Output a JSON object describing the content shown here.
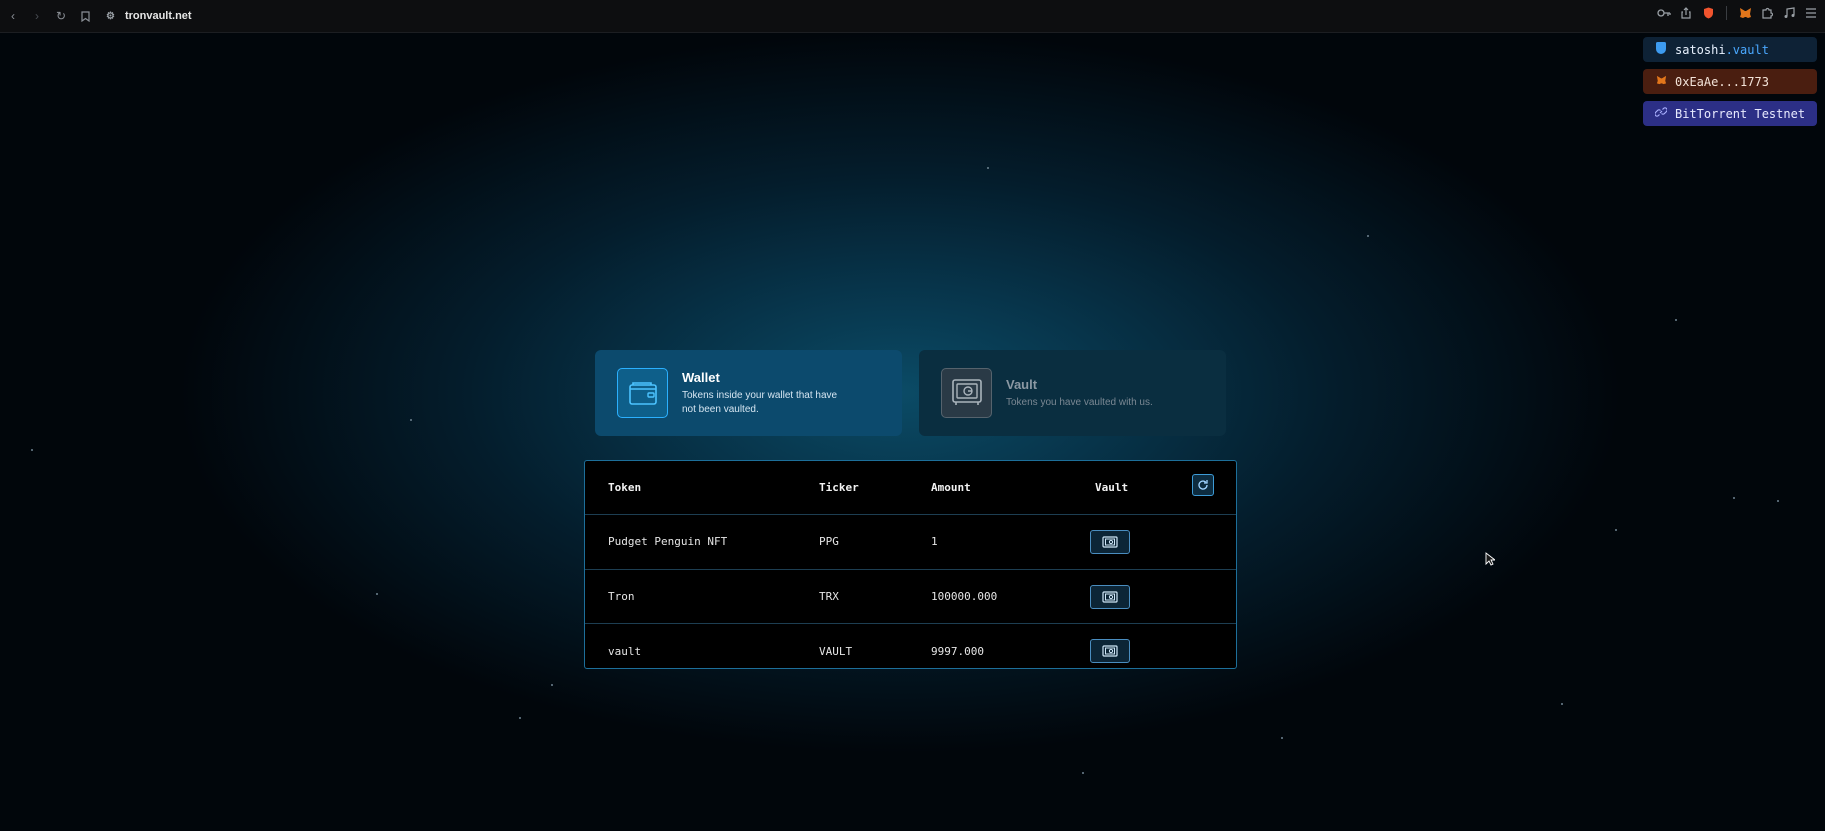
{
  "browser": {
    "url": "tronvault.net",
    "back_icon": "back-arrow-icon",
    "forward_icon": "forward-arrow-icon",
    "reload_icon": "reload-icon",
    "bookmark_icon": "bookmark-icon"
  },
  "account": {
    "name_main": "satoshi",
    "name_suffix": ".vault",
    "address": "0xEaAe...1773",
    "network": "BitTorrent Testnet"
  },
  "tabs": {
    "wallet": {
      "title": "Wallet",
      "description": "Tokens inside your wallet that have not been vaulted."
    },
    "vault": {
      "title": "Vault",
      "description": "Tokens you have vaulted with us."
    }
  },
  "table": {
    "headers": {
      "token": "Token",
      "ticker": "Ticker",
      "amount": "Amount",
      "vault": "Vault"
    },
    "rows": [
      {
        "token": "Pudget Penguin NFT",
        "ticker": "PPG",
        "amount": "1"
      },
      {
        "token": "Tron",
        "ticker": "TRX",
        "amount": "100000.000"
      },
      {
        "token": "vault",
        "ticker": "VAULT",
        "amount": "9997.000"
      }
    ]
  },
  "colors": {
    "accent": "#2bb0ff",
    "wallet_tab_bg": "#0c4a6d",
    "vault_tab_bg": "#0a2e40",
    "network_badge_bg": "#2c2f86",
    "address_badge_bg": "#4a1e10"
  }
}
